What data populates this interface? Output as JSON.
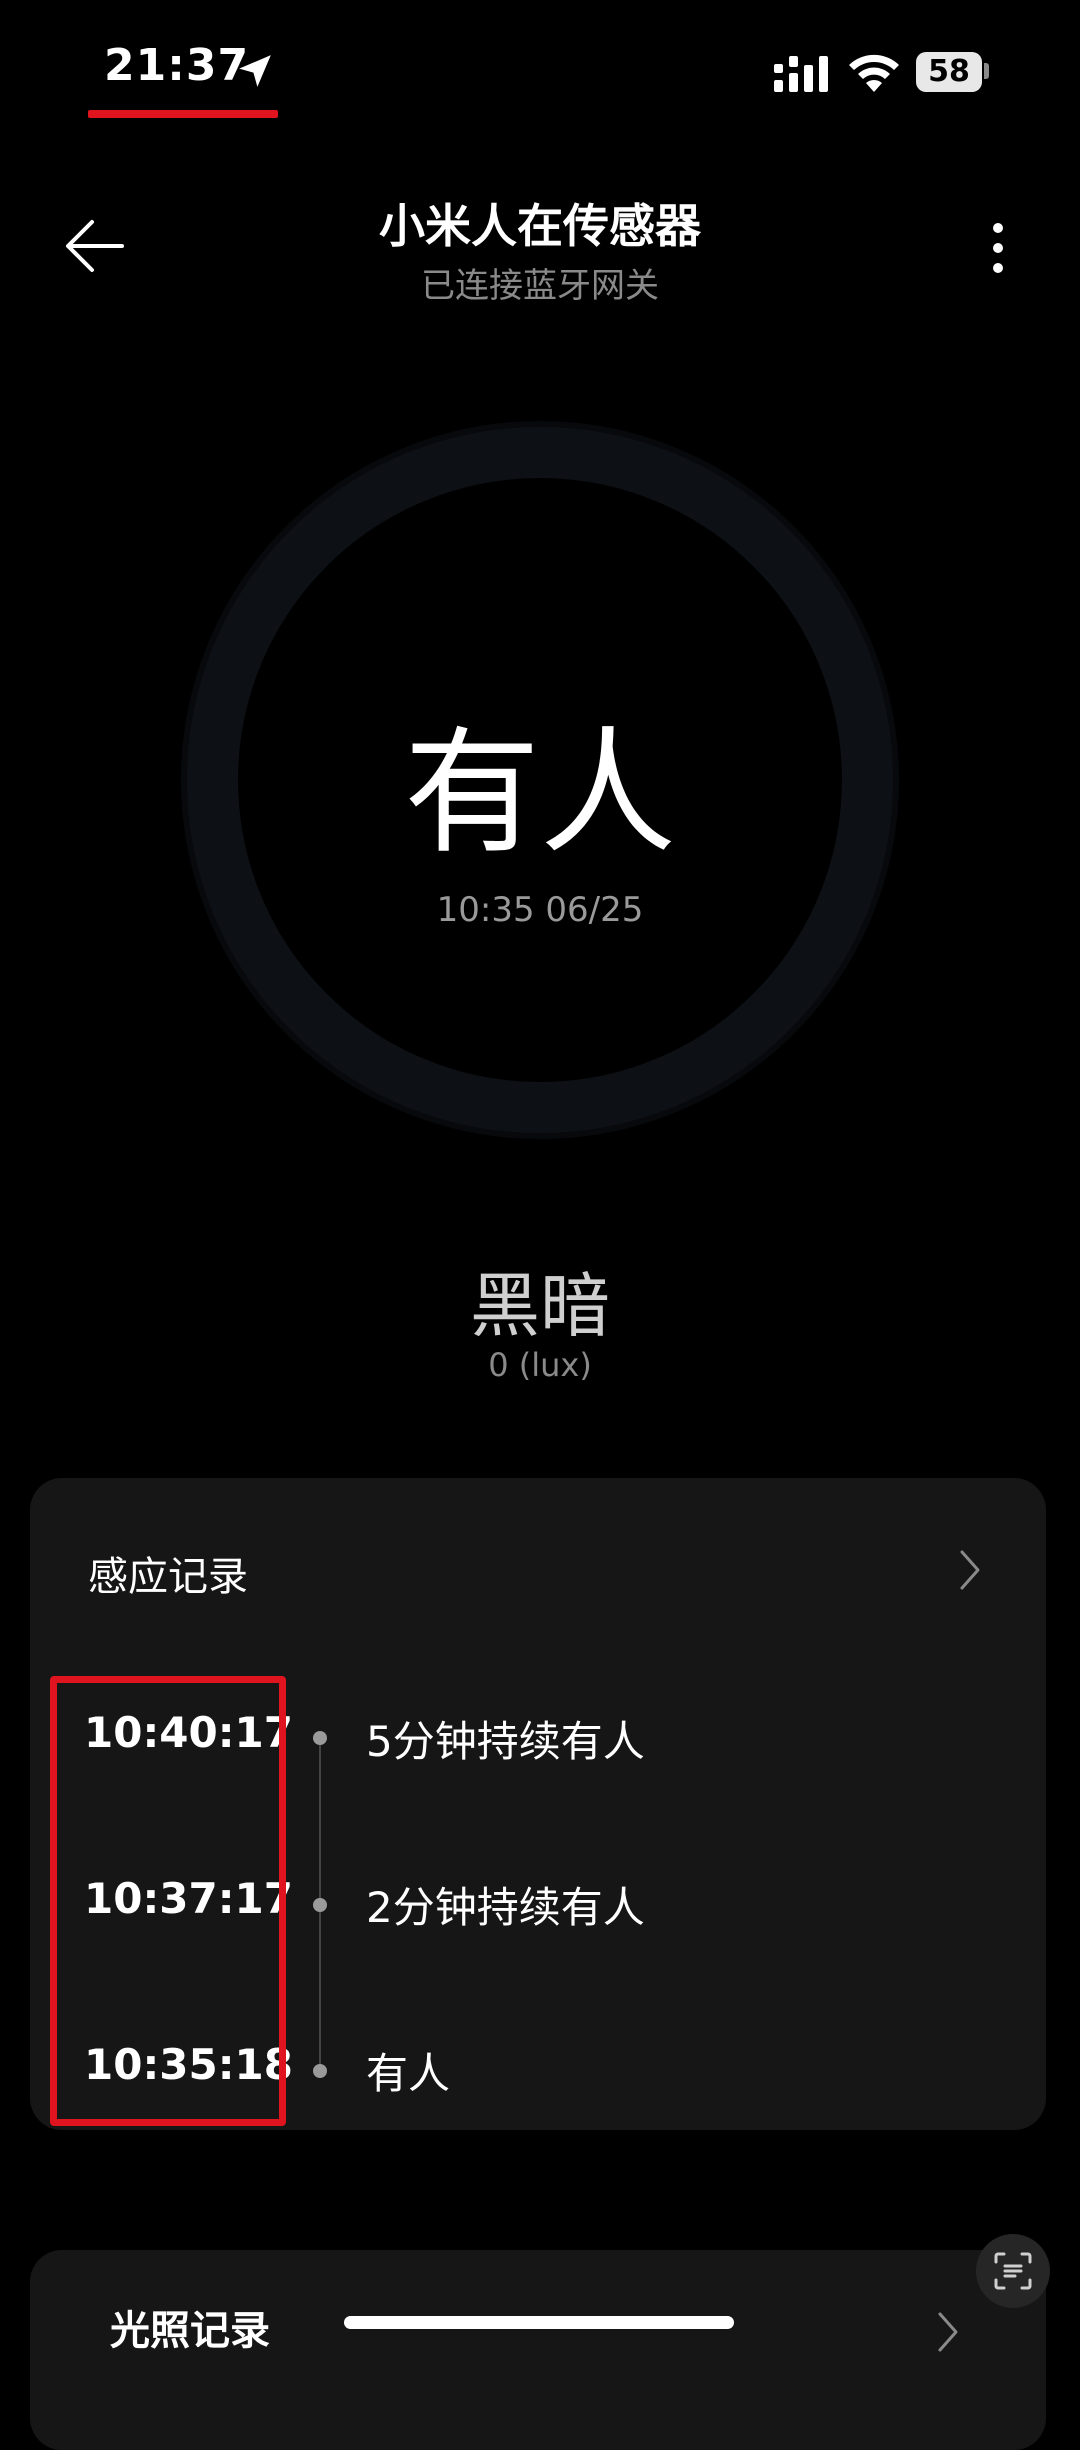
{
  "status_bar": {
    "time": "21:37",
    "battery": "58",
    "icons": [
      "location-arrow-icon",
      "signal-icon",
      "wifi-icon",
      "battery-icon"
    ]
  },
  "header": {
    "title": "小米人在传感器",
    "subtitle": "已连接蓝牙网关",
    "icons": [
      "back-arrow-icon",
      "more-vertical-icon"
    ]
  },
  "presence": {
    "status": "有人",
    "time": "10:35 06/25"
  },
  "light": {
    "status": "黑暗",
    "value": "0 (lux)"
  },
  "sensing_records": {
    "title": "感应记录",
    "records": [
      {
        "time": "10:40:17",
        "label": "5分钟持续有人"
      },
      {
        "time": "10:37:17",
        "label": "2分钟持续有人"
      },
      {
        "time": "10:35:18",
        "label": "有人"
      }
    ]
  },
  "light_records": {
    "title": "光照记录"
  },
  "colors": {
    "background": "#000000",
    "card": "#161616",
    "annotation_red": "#e0141e",
    "ring": "#0d1116"
  }
}
